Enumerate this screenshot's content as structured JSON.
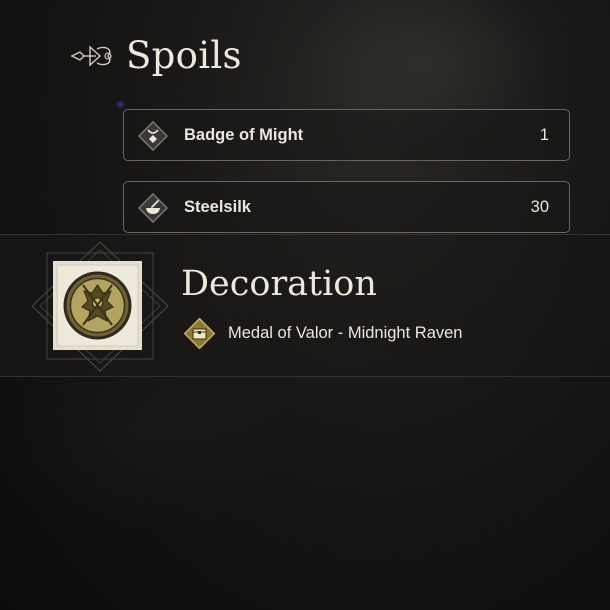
{
  "spoils": {
    "title": "Spoils",
    "items": [
      {
        "name": "Badge of Might",
        "count": "1",
        "icon": "pendant-icon"
      },
      {
        "name": "Steelsilk",
        "count": "30",
        "icon": "mortar-bowl-icon"
      }
    ]
  },
  "decoration": {
    "title": "Decoration",
    "item": {
      "name": "Medal of Valor - Midnight Raven",
      "icon": "gold-chest-icon"
    },
    "image": "medal-of-valor-emblem"
  },
  "colors": {
    "text": "#ece8dc",
    "border": "#6a6760",
    "gold": "#b49a3e",
    "background": "#141311"
  }
}
